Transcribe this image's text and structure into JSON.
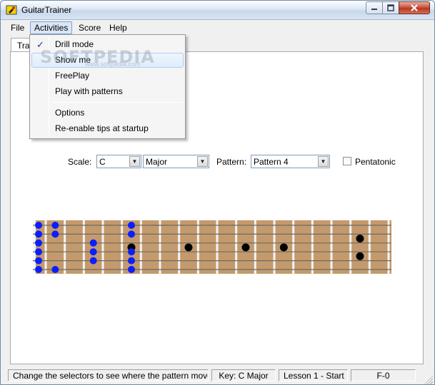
{
  "window": {
    "title": "GuitarTrainer"
  },
  "menubar": {
    "items": [
      {
        "label": "File"
      },
      {
        "label": "Activities"
      },
      {
        "label": "Score"
      },
      {
        "label": "Help"
      }
    ]
  },
  "activities_menu": {
    "items": [
      {
        "label": "Drill mode",
        "checked": true
      },
      {
        "label": "Show me",
        "highlighted": true
      },
      {
        "label": "FreePlay"
      },
      {
        "label": "Play with patterns"
      },
      {
        "label": "Options"
      },
      {
        "label": "Re-enable tips at startup"
      }
    ]
  },
  "tab": {
    "label": "Trai"
  },
  "watermark": {
    "text": "SOFTPEDIA",
    "sub": "www.softpedia.com"
  },
  "controls": {
    "scale_label": "Scale:",
    "scale_key": "C",
    "scale_type": "Major",
    "pattern_label": "Pattern:",
    "pattern_value": "Pattern 4",
    "pentatonic_label": "Pentatonic",
    "pentatonic_checked": false
  },
  "fretboard": {
    "wood_color": "#c49a6c",
    "fret_color": "#f4f4f4",
    "string_color": "#6a6a6a",
    "blue_dot_color": "#0a1fff",
    "black_dot_color": "#000000",
    "fret_count": 18,
    "string_count": 6,
    "blue_notes": [
      {
        "fret": 0,
        "string": 1
      },
      {
        "fret": 0,
        "string": 2
      },
      {
        "fret": 0,
        "string": 3
      },
      {
        "fret": 0,
        "string": 4
      },
      {
        "fret": 0,
        "string": 5
      },
      {
        "fret": 0,
        "string": 6
      },
      {
        "fret": 1,
        "string": 1
      },
      {
        "fret": 1,
        "string": 2
      },
      {
        "fret": 1,
        "string": 6
      },
      {
        "fret": 3,
        "string": 3
      },
      {
        "fret": 3,
        "string": 4
      },
      {
        "fret": 3,
        "string": 5
      },
      {
        "fret": 5,
        "string": 1
      },
      {
        "fret": 5,
        "string": 2
      },
      {
        "fret": 5,
        "string": 4
      },
      {
        "fret": 5,
        "string": 5
      },
      {
        "fret": 5,
        "string": 6
      }
    ],
    "marker_frets": [
      5,
      8,
      11,
      13
    ],
    "double_marker_fret": 17
  },
  "statusbar": {
    "message": "Change the selectors to see where the pattern moves.",
    "key": "Key: C Major",
    "lesson": "Lesson 1 - Start",
    "note": "F-0"
  }
}
